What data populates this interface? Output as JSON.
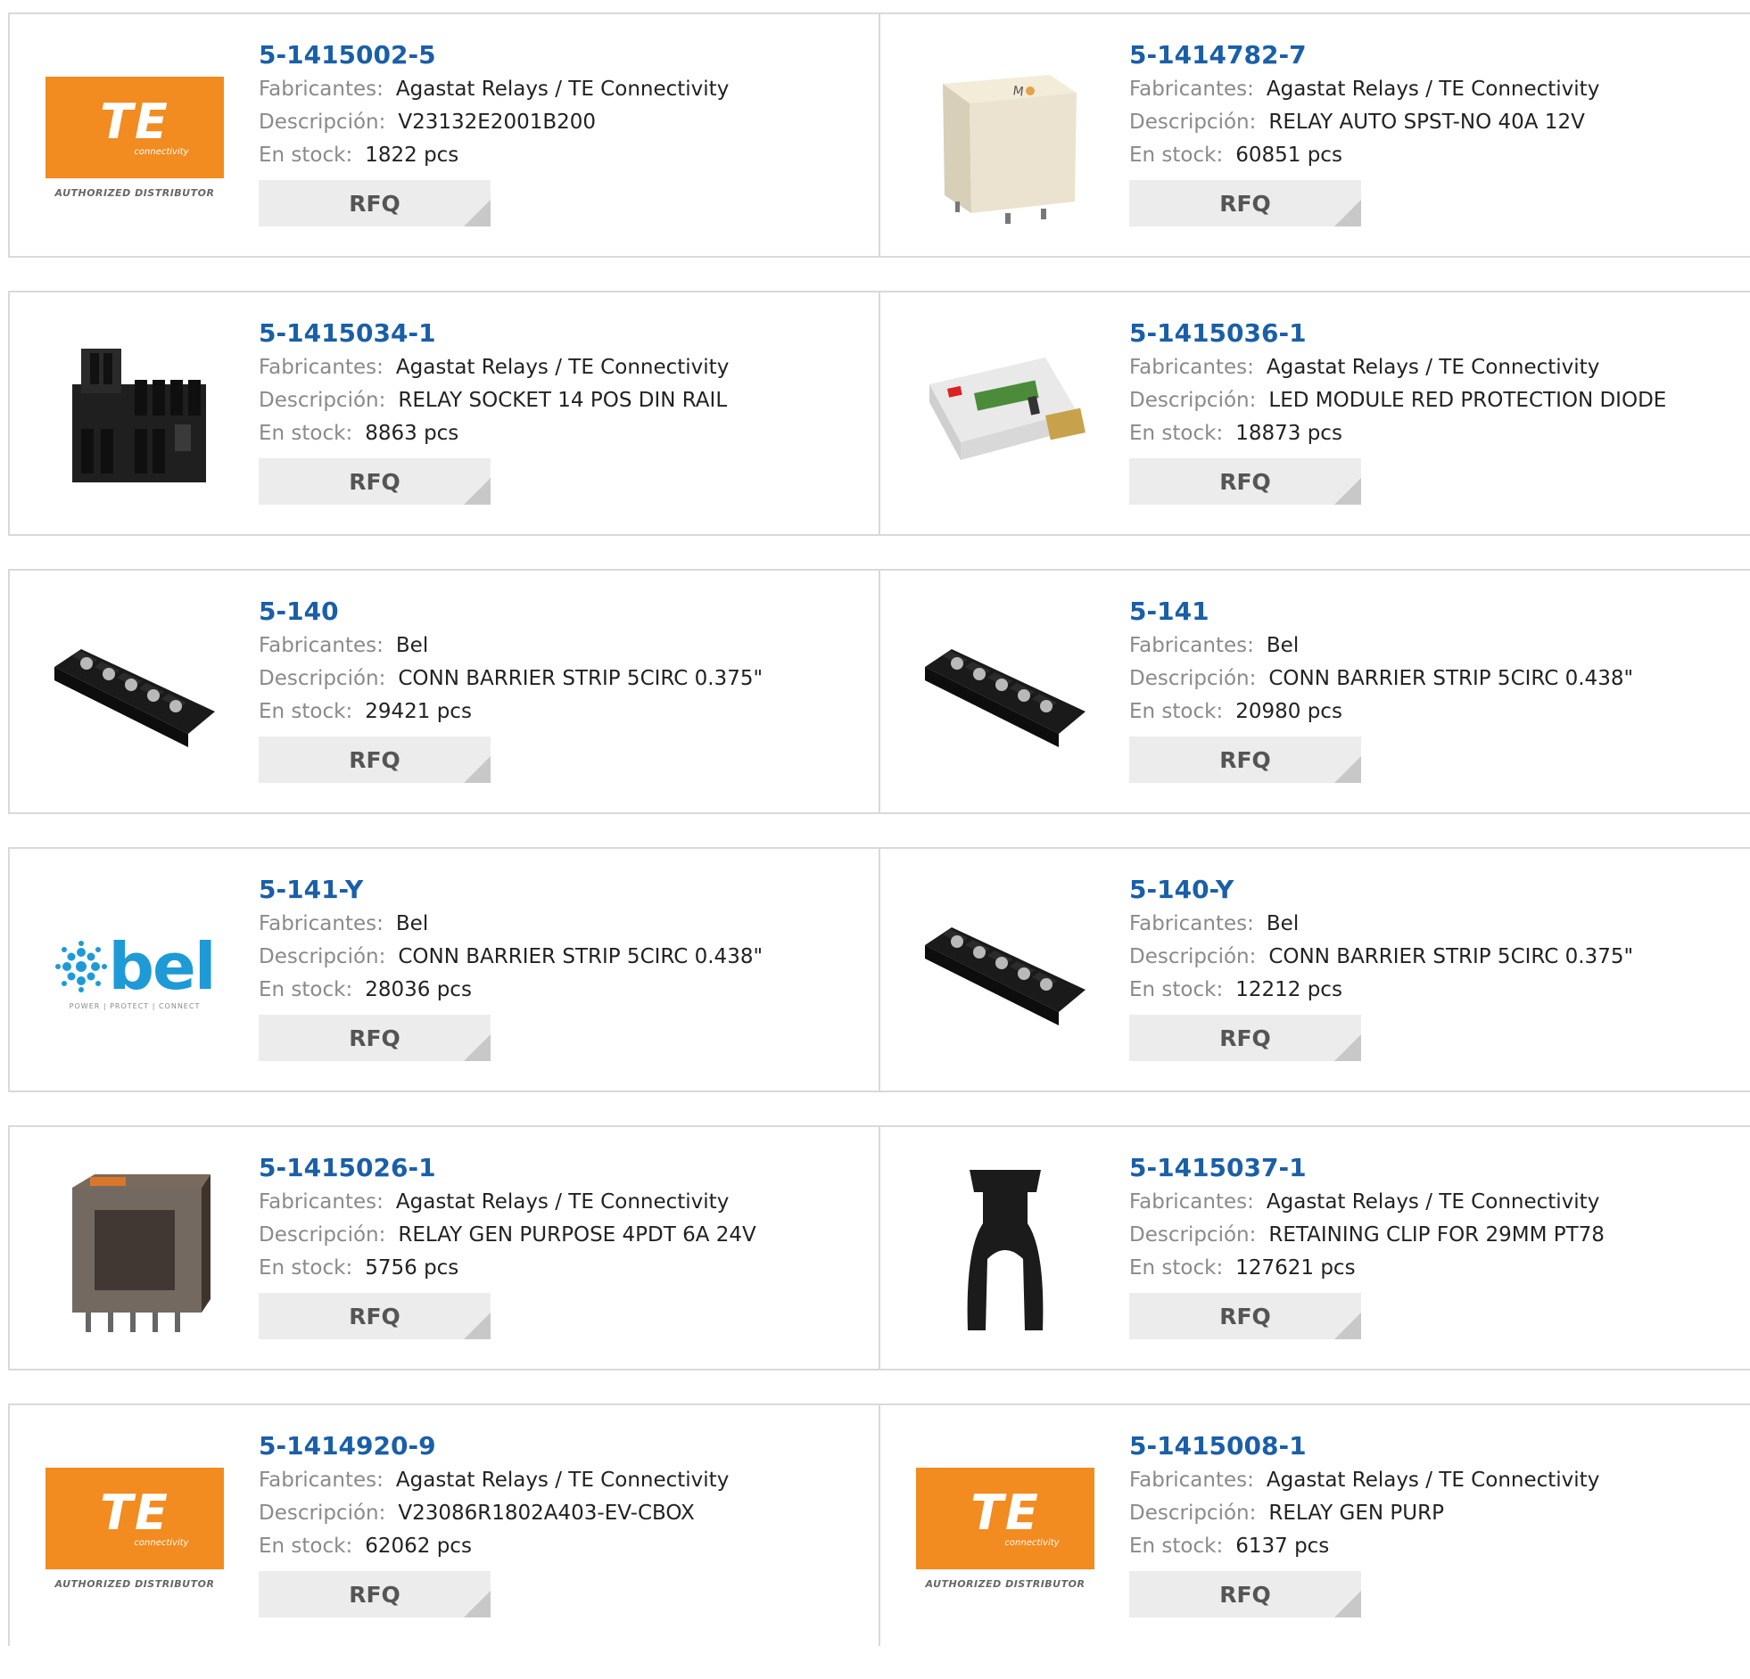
{
  "labels": {
    "manufacturer": "Fabricantes:",
    "description": "Descripción:",
    "stock": "En stock:",
    "rfq": "RFQ"
  },
  "logos": {
    "te_text": "TE",
    "te_sub": "connectivity",
    "te_authorized": "AUTHORIZED DISTRIBUTOR",
    "bel_text": "bel",
    "bel_tag": "POWER | PROTECT | CONNECT"
  },
  "colors": {
    "part_link": "#1a5fa8",
    "label_gray": "#8a8a8a",
    "rfq_bg": "#ececec",
    "te_orange": "#f28b20",
    "bel_blue": "#1e9ad6"
  },
  "products": [
    {
      "part": "5-1415002-5",
      "manufacturer": "Agastat Relays / TE Connectivity",
      "description": "V23132E2001B200",
      "stock": "1822 pcs",
      "image": "te-logo"
    },
    {
      "part": "5-1414782-7",
      "manufacturer": "Agastat Relays / TE Connectivity",
      "description": "RELAY AUTO SPST-NO 40A 12V",
      "stock": "60851 pcs",
      "image": "relay-cube-icon"
    },
    {
      "part": "5-1415034-1",
      "manufacturer": "Agastat Relays / TE Connectivity",
      "description": "RELAY SOCKET 14 POS DIN RAIL",
      "stock": "8863 pcs",
      "image": "relay-socket-icon"
    },
    {
      "part": "5-1415036-1",
      "manufacturer": "Agastat Relays / TE Connectivity",
      "description": "LED MODULE RED PROTECTION DIODE",
      "stock": "18873 pcs",
      "image": "led-module-icon"
    },
    {
      "part": "5-140",
      "manufacturer": "Bel",
      "description": "CONN BARRIER STRIP 5CIRC 0.375\"",
      "stock": "29421 pcs",
      "image": "barrier-strip-icon"
    },
    {
      "part": "5-141",
      "manufacturer": "Bel",
      "description": "CONN BARRIER STRIP 5CIRC 0.438\"",
      "stock": "20980 pcs",
      "image": "barrier-strip-icon"
    },
    {
      "part": "5-141-Y",
      "manufacturer": "Bel",
      "description": "CONN BARRIER STRIP 5CIRC 0.438\"",
      "stock": "28036 pcs",
      "image": "bel-logo"
    },
    {
      "part": "5-140-Y",
      "manufacturer": "Bel",
      "description": "CONN BARRIER STRIP 5CIRC 0.375\"",
      "stock": "12212 pcs",
      "image": "barrier-strip-icon"
    },
    {
      "part": "5-1415026-1",
      "manufacturer": "Agastat Relays / TE Connectivity",
      "description": "RELAY GEN PURPOSE 4PDT 6A 24V",
      "stock": "5756 pcs",
      "image": "relay-clear-icon"
    },
    {
      "part": "5-1415037-1",
      "manufacturer": "Agastat Relays / TE Connectivity",
      "description": "RETAINING CLIP FOR 29MM PT78",
      "stock": "127621 pcs",
      "image": "retaining-clip-icon"
    },
    {
      "part": "5-1414920-9",
      "manufacturer": "Agastat Relays / TE Connectivity",
      "description": "V23086R1802A403-EV-CBOX",
      "stock": "62062 pcs",
      "image": "te-logo"
    },
    {
      "part": "5-1415008-1",
      "manufacturer": "Agastat Relays / TE Connectivity",
      "description": "RELAY GEN PURP",
      "stock": "6137 pcs",
      "image": "te-logo"
    }
  ]
}
